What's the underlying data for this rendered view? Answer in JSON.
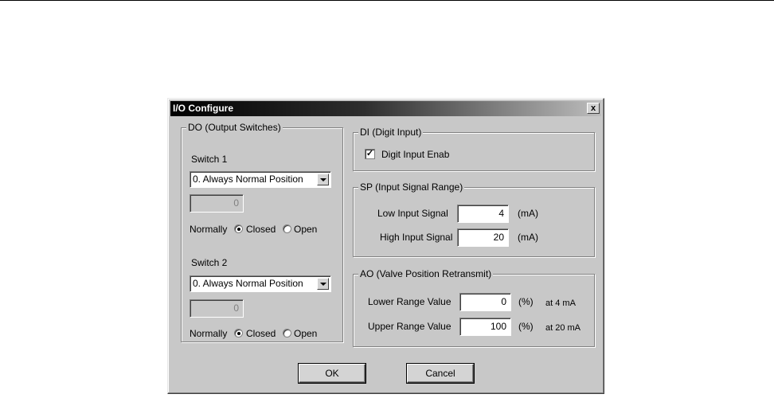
{
  "dialog": {
    "title": "I/O Configure",
    "close_glyph": "x"
  },
  "do_group": {
    "title": "DO (Output Switches)",
    "switch1": {
      "label": "Switch 1",
      "select_value": "0. Always Normal Position",
      "field_value": "0",
      "normally_label": "Normally",
      "closed_label": "Closed",
      "open_label": "Open",
      "selected": "Closed"
    },
    "switch2": {
      "label": "Switch 2",
      "select_value": "0. Always Normal Position",
      "field_value": "0",
      "normally_label": "Normally",
      "closed_label": "Closed",
      "open_label": "Open",
      "selected": "Closed"
    }
  },
  "di_group": {
    "title": "DI (Digit Input)",
    "checkbox_label": "Digit Input Enab",
    "checkbox_checked": true,
    "check_glyph": "✓"
  },
  "sp_group": {
    "title": "SP (Input Signal Range)",
    "low_label": "Low Input Signal",
    "low_value": "4",
    "low_unit": "(mA)",
    "high_label": "High Input Signal",
    "high_value": "20",
    "high_unit": "(mA)"
  },
  "ao_group": {
    "title": "AO (Valve Position Retransmit)",
    "lower_label": "Lower Range Value",
    "lower_value": "0",
    "lower_unit": "(%)",
    "lower_note": "at 4 mA",
    "upper_label": "Upper Range Value",
    "upper_value": "100",
    "upper_unit": "(%)",
    "upper_note": "at 20 mA"
  },
  "buttons": {
    "ok_label": "OK",
    "cancel_label": "Cancel"
  }
}
